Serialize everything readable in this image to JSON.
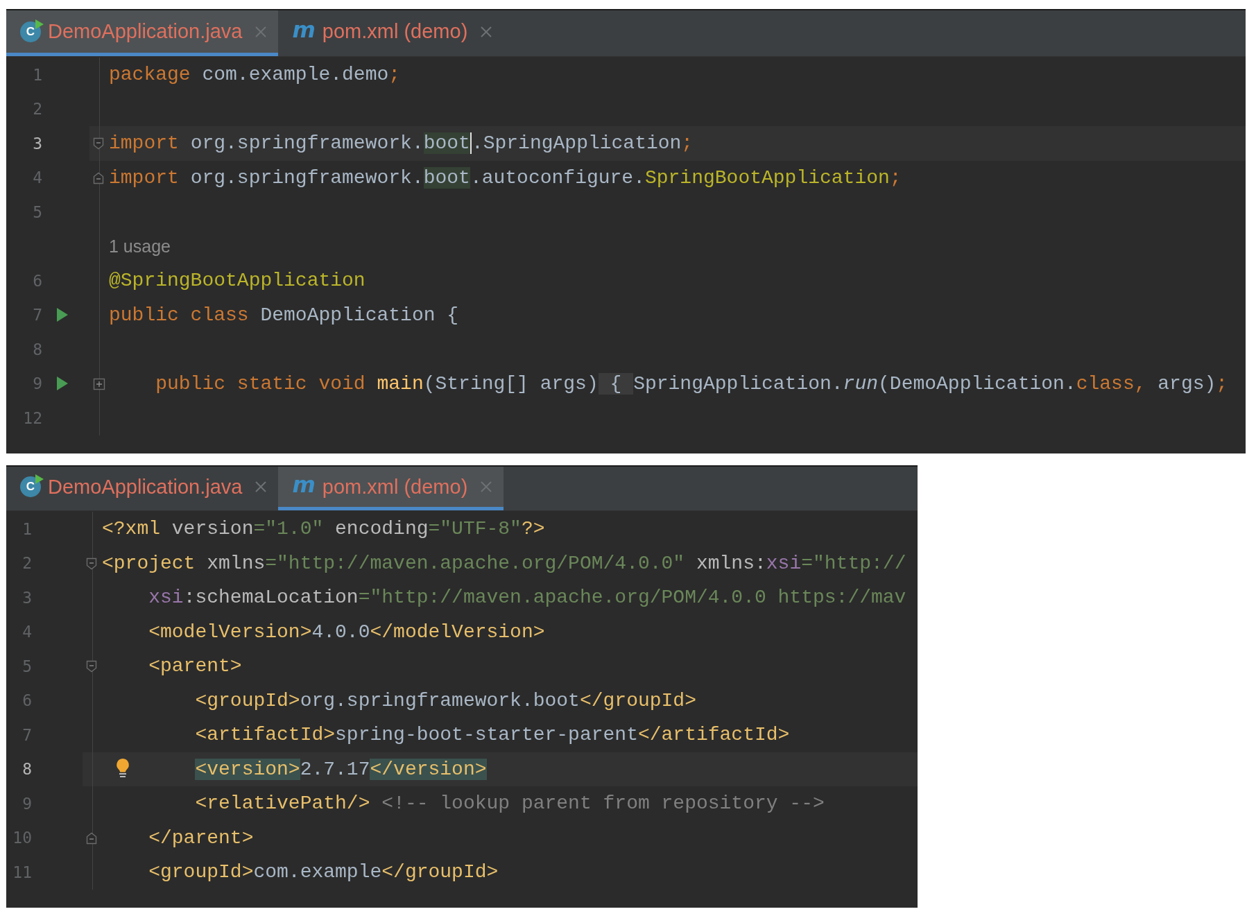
{
  "panels": [
    {
      "tabs": [
        {
          "label": "DemoApplication.java",
          "selected": true,
          "kind": "class",
          "icon_text": "C"
        },
        {
          "label": "pom.xml (demo)",
          "selected": false,
          "kind": "maven",
          "icon_text": "m"
        }
      ],
      "lines": [
        {
          "kind": "code",
          "number": "1",
          "current": false,
          "tokens": [
            {
              "kind": "keyword",
              "text": "package"
            },
            {
              "kind": "plain",
              "text": " com.example.demo"
            },
            {
              "kind": "keyword",
              "text": ";"
            }
          ]
        },
        {
          "kind": "code",
          "number": "2",
          "current": false
        },
        {
          "kind": "code",
          "number": "3",
          "current": true,
          "gutter": [
            {
              "kind": "fold-start"
            }
          ],
          "tokens": [
            {
              "kind": "keyword",
              "text": "import"
            },
            {
              "kind": "plain",
              "text": " org.springframework."
            },
            {
              "kind": "hit-caret",
              "text": "boot"
            },
            {
              "kind": "plain",
              "text": ".SpringApplication"
            },
            {
              "kind": "keyword",
              "text": ";"
            }
          ]
        },
        {
          "kind": "code",
          "number": "4",
          "current": false,
          "gutter": [
            {
              "kind": "fold-end"
            }
          ],
          "tokens": [
            {
              "kind": "keyword",
              "text": "import"
            },
            {
              "kind": "plain",
              "text": " org.springframework."
            },
            {
              "kind": "hit",
              "text": "boot"
            },
            {
              "kind": "plain",
              "text": ".autoconfigure."
            },
            {
              "kind": "annotation",
              "text": "SpringBootApplication"
            },
            {
              "kind": "keyword",
              "text": ";"
            }
          ]
        },
        {
          "kind": "code",
          "number": "5",
          "current": false
        },
        {
          "kind": "inlay",
          "text": "1 usage"
        },
        {
          "kind": "code",
          "number": "6",
          "current": false,
          "tokens": [
            {
              "kind": "annotation",
              "text": "@SpringBootApplication"
            }
          ]
        },
        {
          "kind": "code",
          "number": "7",
          "current": false,
          "gutter": [
            {
              "kind": "run"
            }
          ],
          "tokens": [
            {
              "kind": "keyword",
              "text": "public class"
            },
            {
              "kind": "plain",
              "text": " DemoApplication {"
            }
          ]
        },
        {
          "kind": "code",
          "number": "8",
          "current": false
        },
        {
          "kind": "code",
          "number": "9",
          "current": false,
          "gutter": [
            {
              "kind": "run"
            },
            {
              "kind": "folded"
            }
          ],
          "tokens": [
            {
              "kind": "keyword",
              "text": "    public static void "
            },
            {
              "kind": "method",
              "text": "main"
            },
            {
              "kind": "plain",
              "text": "(String[] args)"
            },
            {
              "kind": "folded",
              "text": " { "
            },
            {
              "kind": "plain",
              "text": "SpringApplication."
            },
            {
              "kind": "static-call",
              "text": "run"
            },
            {
              "kind": "plain",
              "text": "(DemoApplication."
            },
            {
              "kind": "keyword",
              "text": "class,"
            },
            {
              "kind": "plain",
              "text": " args)"
            },
            {
              "kind": "keyword",
              "text": ";"
            }
          ]
        },
        {
          "kind": "code",
          "number": "12",
          "current": false
        }
      ]
    },
    {
      "tabs": [
        {
          "label": "DemoApplication.java",
          "selected": false,
          "kind": "class",
          "icon_text": "C"
        },
        {
          "label": "pom.xml (demo)",
          "selected": true,
          "kind": "maven",
          "icon_text": "m"
        }
      ],
      "lines": [
        {
          "kind": "code",
          "number": "1",
          "current": false,
          "tokens": [
            {
              "kind": "tag",
              "text": "<?xml"
            },
            {
              "kind": "attribute",
              "text": " version"
            },
            {
              "kind": "string",
              "text": "=\"1.0\""
            },
            {
              "kind": "attribute",
              "text": " encoding"
            },
            {
              "kind": "string",
              "text": "=\"UTF-8\""
            },
            {
              "kind": "tag",
              "text": "?>"
            }
          ]
        },
        {
          "kind": "code",
          "number": "2",
          "current": false,
          "gutter": [
            {
              "kind": "fold-start"
            }
          ],
          "tokens": [
            {
              "kind": "tag",
              "text": "<project"
            },
            {
              "kind": "attribute",
              "text": " xmlns"
            },
            {
              "kind": "string",
              "text": "=\"http://maven.apache.org/POM/4.0.0\""
            },
            {
              "kind": "attribute",
              "text": " xmlns:"
            },
            {
              "kind": "namespace",
              "text": "xsi"
            },
            {
              "kind": "string",
              "text": "=\"http://"
            }
          ]
        },
        {
          "kind": "code",
          "number": "3",
          "current": false,
          "tokens": [
            {
              "kind": "namespace",
              "text": "    xsi"
            },
            {
              "kind": "attribute",
              "text": ":schemaLocation"
            },
            {
              "kind": "string",
              "text": "=\"http://maven.apache.org/POM/4.0.0 https://mav"
            }
          ]
        },
        {
          "kind": "code",
          "number": "4",
          "current": false,
          "tokens": [
            {
              "kind": "tag",
              "text": "    <modelVersion>"
            },
            {
              "kind": "plain",
              "text": "4.0.0"
            },
            {
              "kind": "tag",
              "text": "</modelVersion>"
            }
          ]
        },
        {
          "kind": "code",
          "number": "5",
          "current": false,
          "gutter": [
            {
              "kind": "fold-start"
            }
          ],
          "tokens": [
            {
              "kind": "tag",
              "text": "    <parent>"
            }
          ]
        },
        {
          "kind": "code",
          "number": "6",
          "current": false,
          "tokens": [
            {
              "kind": "tag",
              "text": "        <groupId>"
            },
            {
              "kind": "plain",
              "text": "org.springframework.boot"
            },
            {
              "kind": "tag",
              "text": "</groupId>"
            }
          ]
        },
        {
          "kind": "code",
          "number": "7",
          "current": false,
          "tokens": [
            {
              "kind": "tag",
              "text": "        <artifactId>"
            },
            {
              "kind": "plain",
              "text": "spring-boot-starter-parent"
            },
            {
              "kind": "tag",
              "text": "</artifactId>"
            }
          ]
        },
        {
          "kind": "code",
          "number": "8",
          "current": true,
          "gutter": [
            {
              "kind": "bulb"
            }
          ],
          "tokens": [
            {
              "kind": "tag-hit",
              "text": "        <version>"
            },
            {
              "kind": "plain",
              "text": "2.7.17"
            },
            {
              "kind": "tag-hit",
              "text": "</version>"
            }
          ]
        },
        {
          "kind": "code",
          "number": "9",
          "current": false,
          "tokens": [
            {
              "kind": "tag",
              "text": "        <relativePath/>"
            },
            {
              "kind": "comment",
              "text": " <!-- lookup parent from repository -->"
            }
          ]
        },
        {
          "kind": "code",
          "number": "10",
          "current": false,
          "gutter": [
            {
              "kind": "fold-end"
            }
          ],
          "tokens": [
            {
              "kind": "tag",
              "text": "    </parent>"
            }
          ]
        },
        {
          "kind": "code",
          "number": "11",
          "current": false,
          "tokens": [
            {
              "kind": "tag",
              "text": "    <groupId>"
            },
            {
              "kind": "plain",
              "text": "com.example"
            },
            {
              "kind": "tag",
              "text": "</groupId>"
            }
          ]
        }
      ]
    }
  ]
}
